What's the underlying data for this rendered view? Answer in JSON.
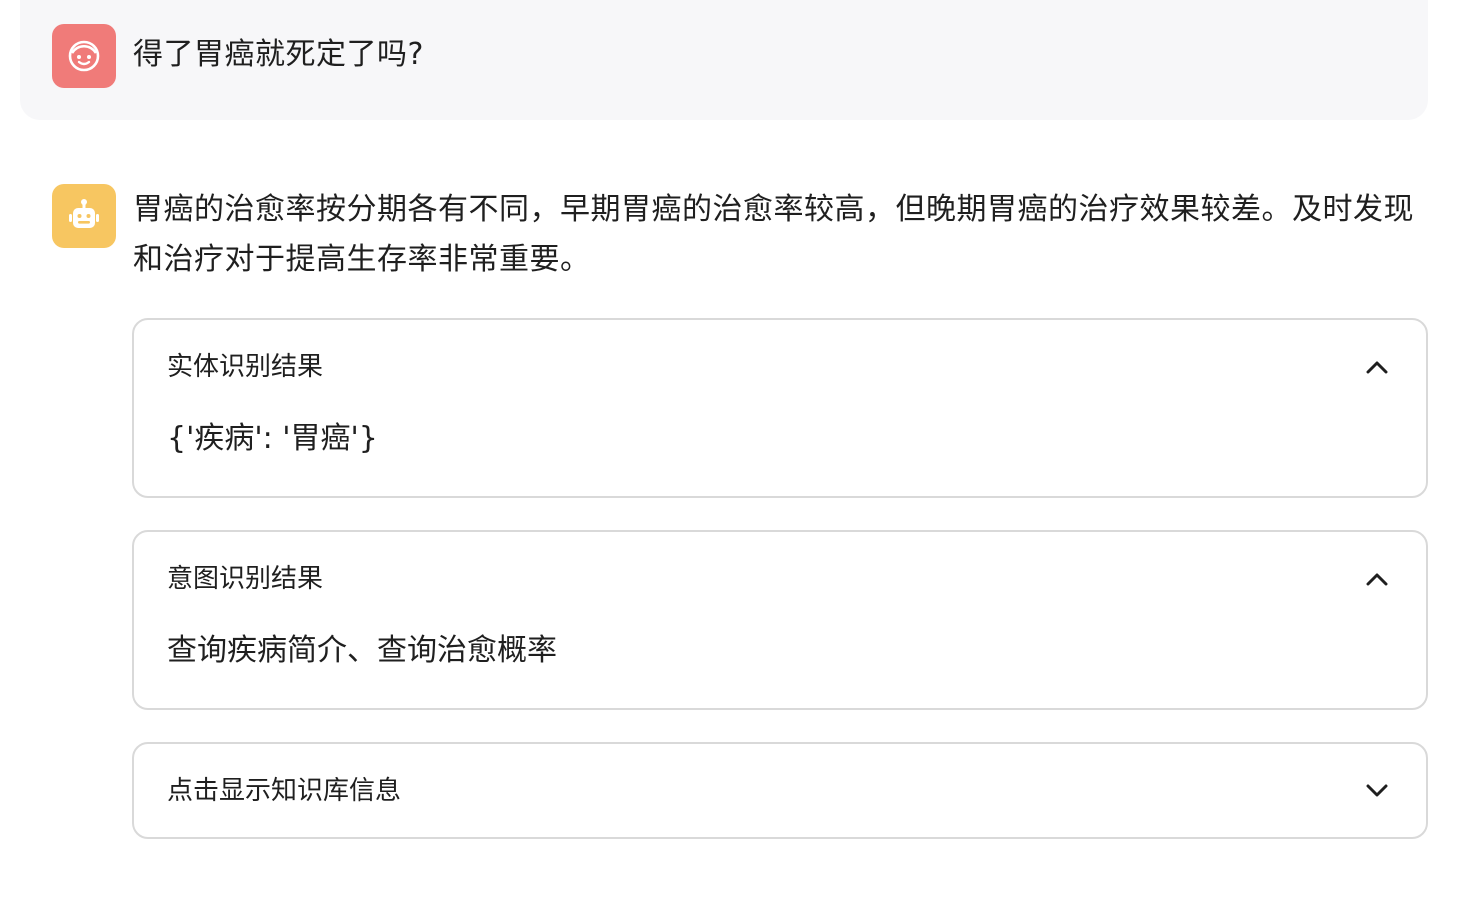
{
  "user_message": {
    "text": "得了胃癌就死定了吗?",
    "avatar_icon": "smiley-face-icon",
    "avatar_color": "#f07b79"
  },
  "bot_message": {
    "text": "胃癌的治愈率按分期各有不同，早期胃癌的治愈率较高，但晚期胃癌的治疗效果较差。及时发现和治疗对于提高生存率非常重要。",
    "avatar_icon": "robot-icon",
    "avatar_color": "#f7c661"
  },
  "panels": [
    {
      "title": "实体识别结果",
      "content": "{'疾病': '胃癌'}",
      "expanded": true
    },
    {
      "title": "意图识别结果",
      "content": "查询疾病简介、查询治愈概率",
      "expanded": true
    },
    {
      "title": "点击显示知识库信息",
      "content": "",
      "expanded": false
    }
  ]
}
